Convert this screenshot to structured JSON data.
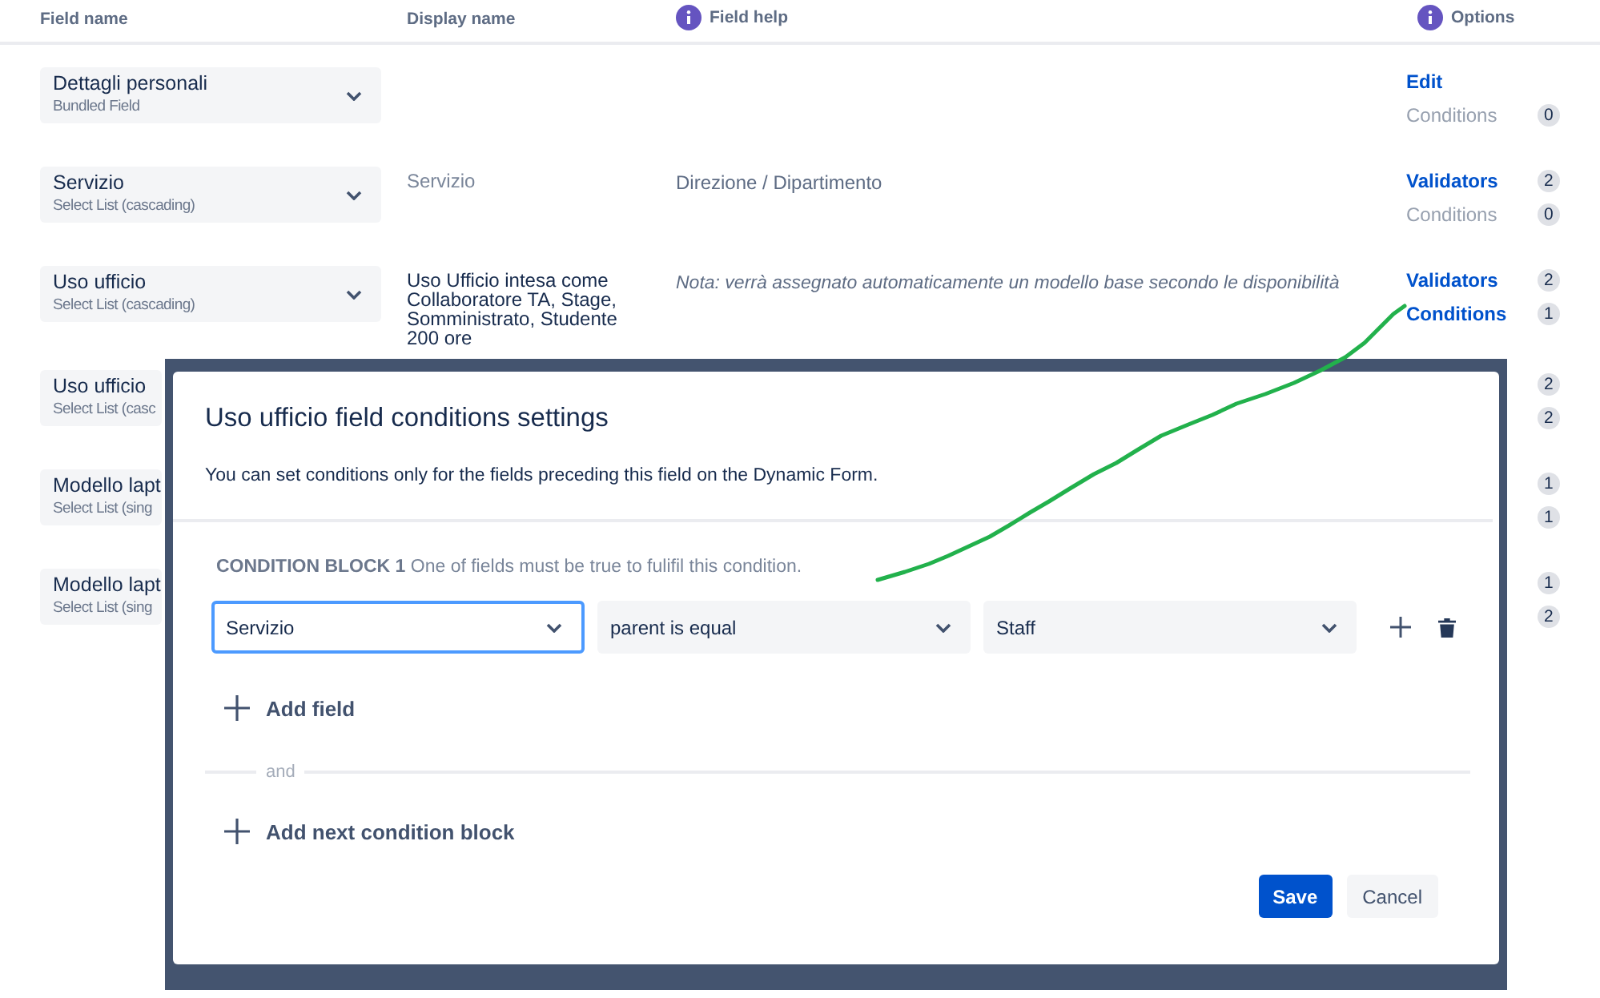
{
  "table": {
    "columns": [
      {
        "label": "Field name",
        "info": false
      },
      {
        "label": "Display name",
        "info": false
      },
      {
        "label": "Field help",
        "info": true
      },
      {
        "label": "Options",
        "info": true
      }
    ],
    "rows": [
      {
        "field": {
          "name": "Dettagli personali",
          "type": "Bundled Field",
          "covered": false
        },
        "options": [
          {
            "label": "Edit",
            "active": true
          },
          {
            "label": "Conditions",
            "active": false,
            "count": "0"
          }
        ]
      },
      {
        "field": {
          "name": "Servizio",
          "type": "Select List (cascading)",
          "covered": false
        },
        "display_name": {
          "text": "Servizio",
          "muted": true
        },
        "help": {
          "text": "Direzione / Dipartimento",
          "italic": false
        },
        "options": [
          {
            "label": "Validators",
            "active": true,
            "count": "2"
          },
          {
            "label": "Conditions",
            "active": false,
            "count": "0"
          }
        ]
      },
      {
        "field": {
          "name": "Uso ufficio",
          "type": "Select List (cascading)",
          "covered": false
        },
        "display_name": {
          "text": "Uso Ufficio intesa come Collaboratore TA, Stage, Somministrato, Studente 200 ore",
          "muted": false
        },
        "help": {
          "text": "Nota: verrà assegnato automaticamente un modello base secondo le disponibilità",
          "italic": true
        },
        "options": [
          {
            "label": "Validators",
            "active": true,
            "count": "2"
          },
          {
            "label": "Conditions",
            "active": true,
            "count": "1"
          }
        ]
      },
      {
        "field": {
          "name": "Uso ufficio",
          "type": "Select List (casc",
          "covered": true
        },
        "options": [
          {
            "count": "2"
          },
          {
            "count": "2"
          }
        ]
      },
      {
        "field": {
          "name": "Modello lapt",
          "type": "Select List (sing",
          "covered": true
        },
        "options": [
          {
            "count": "1"
          },
          {
            "count": "1"
          }
        ]
      },
      {
        "field": {
          "name": "Modello lapt",
          "type": "Select List (sing",
          "covered": true
        },
        "options": [
          {
            "count": "1"
          },
          {
            "count": "2"
          }
        ]
      }
    ]
  },
  "dialog": {
    "title": "Uso ufficio field conditions settings",
    "description": "You can set conditions only for the fields preceding this field on the Dynamic Form.",
    "blocks": [
      {
        "heading": "CONDITION BLOCK 1",
        "hint": "One of fields must be true to fulifil this condition.",
        "conditions": [
          {
            "selects": [
              {
                "value": "Servizio",
                "focused": true
              },
              {
                "value": "parent is equal",
                "focused": false
              },
              {
                "value": "Staff",
                "focused": false
              }
            ]
          }
        ],
        "add_field": "Add field"
      }
    ],
    "separator": "and",
    "add_block": "Add next condition block",
    "buttons": [
      {
        "label": "Save",
        "kind": "primary"
      },
      {
        "label": "Cancel",
        "kind": "subtle"
      }
    ]
  }
}
